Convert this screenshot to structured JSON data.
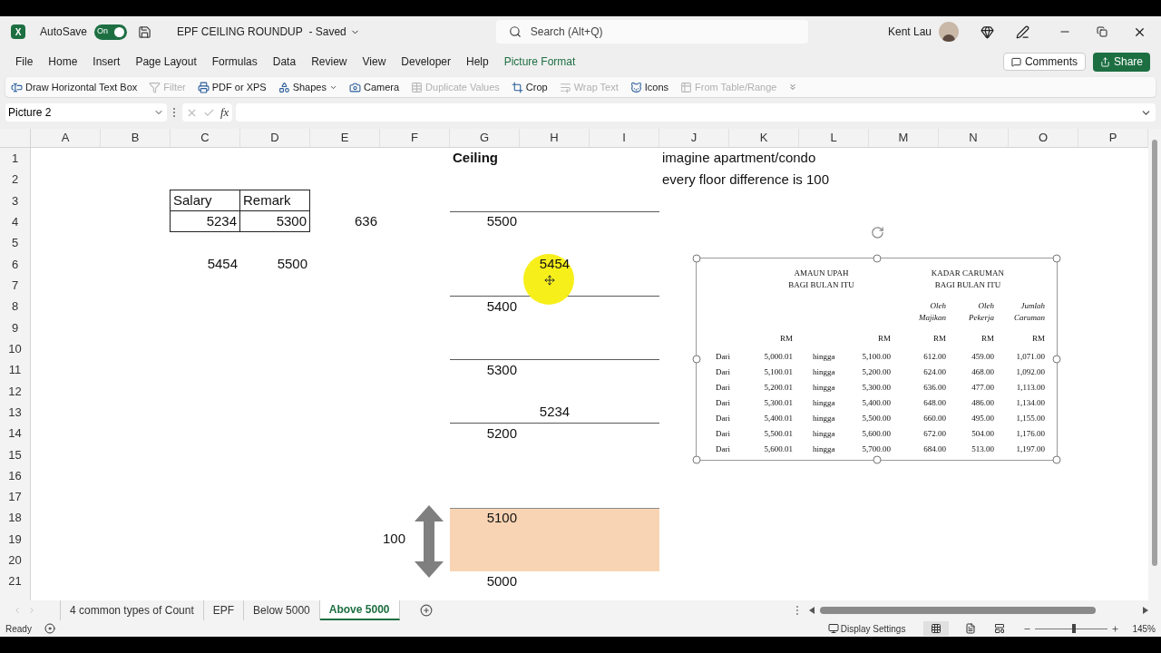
{
  "title_bar": {
    "app_logo": "X",
    "autosave_label": "AutoSave",
    "autosave": {
      "on": true,
      "label": "On"
    },
    "document_title": "EPF CEILING ROUNDUP",
    "save_status": "- Saved",
    "search_placeholder": "Search (Alt+Q)",
    "user_name": "Kent Lau"
  },
  "menu": [
    {
      "label": "File",
      "kind": "tab"
    },
    {
      "label": "Home",
      "kind": "tab"
    },
    {
      "label": "Insert",
      "kind": "tab"
    },
    {
      "label": "Page Layout",
      "kind": "tab"
    },
    {
      "label": "Formulas",
      "kind": "tab"
    },
    {
      "label": "Data",
      "kind": "tab"
    },
    {
      "label": "Review",
      "kind": "tab"
    },
    {
      "label": "View",
      "kind": "tab"
    },
    {
      "label": "Developer",
      "kind": "tab"
    },
    {
      "label": "Help",
      "kind": "tab"
    },
    {
      "label": "Picture Format",
      "kind": "contextual"
    }
  ],
  "ribbon_buttons": [
    "Comments",
    "Share"
  ],
  "quick_access": [
    {
      "label": "Draw Horizontal Text Box",
      "disabled": false,
      "dropdown": false
    },
    {
      "label": "Filter",
      "disabled": true,
      "dropdown": false
    },
    {
      "label": "PDF or XPS",
      "disabled": false,
      "dropdown": false
    },
    {
      "label": "Shapes",
      "disabled": false,
      "dropdown": true
    },
    {
      "label": "Camera",
      "disabled": false,
      "dropdown": false
    },
    {
      "label": "Duplicate Values",
      "disabled": true,
      "dropdown": false
    },
    {
      "label": "Crop",
      "disabled": false,
      "dropdown": false
    },
    {
      "label": "Wrap Text",
      "disabled": true,
      "dropdown": false
    },
    {
      "label": "Icons",
      "disabled": false,
      "dropdown": false
    },
    {
      "label": "From Table/Range",
      "disabled": true,
      "dropdown": false
    }
  ],
  "formula_bar": {
    "name_box": "Picture 2",
    "function_label": "fx"
  },
  "columns": [
    "A",
    "B",
    "C",
    "D",
    "E",
    "F",
    "G",
    "H",
    "I",
    "J",
    "K",
    "L",
    "M",
    "N",
    "O",
    "P"
  ],
  "rows": [
    "1",
    "2",
    "3",
    "4",
    "5",
    "6",
    "7",
    "8",
    "9",
    "10",
    "11",
    "12",
    "13",
    "14",
    "15",
    "16",
    "17",
    "18",
    "19",
    "20",
    "21"
  ],
  "cells": [
    {
      "text": "Ceiling",
      "kind": "bold",
      "bordered": false
    },
    {
      "text": "imagine apartment/condo",
      "kind": "text",
      "bordered": false
    },
    {
      "text": "every floor difference is 100",
      "kind": "text",
      "bordered": false
    },
    {
      "text": "Salary",
      "kind": "text",
      "bordered": true
    },
    {
      "text": "Remark",
      "kind": "text",
      "bordered": true
    },
    {
      "text": "5234",
      "kind": "number",
      "bordered": true
    },
    {
      "text": "5300",
      "kind": "number",
      "bordered": true
    },
    {
      "text": "636",
      "kind": "number",
      "bordered": false
    },
    {
      "text": "5500",
      "kind": "number",
      "bordered": false
    },
    {
      "text": "5454",
      "kind": "number",
      "bordered": false
    },
    {
      "text": "5500",
      "kind": "number",
      "bordered": false
    },
    {
      "text": "5454",
      "kind": "center",
      "bordered": false
    },
    {
      "text": "5400",
      "kind": "number",
      "bordered": false
    },
    {
      "text": "5300",
      "kind": "number",
      "bordered": false
    },
    {
      "text": "5234",
      "kind": "center",
      "bordered": false
    },
    {
      "text": "5200",
      "kind": "number",
      "bordered": false
    },
    {
      "text": "5100",
      "kind": "number",
      "bordered": false
    },
    {
      "text": "100",
      "kind": "text",
      "bordered": false
    },
    {
      "text": "5000",
      "kind": "number",
      "bordered": false
    }
  ],
  "epf_table": {
    "group_headers": [
      [
        "AMAUN UPAH",
        "BAGI BULAN ITU"
      ],
      [
        "KADAR CARUMAN",
        "BAGI BULAN ITU"
      ]
    ],
    "sub_headers": [
      [
        "Oleh",
        "Majikan"
      ],
      [
        "Oleh",
        "Pekerja"
      ],
      [
        "Jumlah",
        "Caruman"
      ]
    ],
    "currency": [
      "RM",
      "RM",
      "RM",
      "RM",
      "RM"
    ],
    "rows": [
      [
        "Dari",
        "5,000.01",
        "hingga",
        "5,100.00",
        "612.00",
        "459.00",
        "1,071.00"
      ],
      [
        "Dari",
        "5,100.01",
        "hingga",
        "5,200.00",
        "624.00",
        "468.00",
        "1,092.00"
      ],
      [
        "Dari",
        "5,200.01",
        "hingga",
        "5,300.00",
        "636.00",
        "477.00",
        "1,113.00"
      ],
      [
        "Dari",
        "5,300.01",
        "hingga",
        "5,400.00",
        "648.00",
        "486.00",
        "1,134.00"
      ],
      [
        "Dari",
        "5,400.01",
        "hingga",
        "5,500.00",
        "660.00",
        "495.00",
        "1,155.00"
      ],
      [
        "Dari",
        "5,500.01",
        "hingga",
        "5,600.00",
        "672.00",
        "504.00",
        "1,176.00"
      ],
      [
        "Dari",
        "5,600.01",
        "hingga",
        "5,700.00",
        "684.00",
        "513.00",
        "1,197.00"
      ]
    ]
  },
  "sheet_tabs": [
    {
      "label": "4 common types of Count",
      "selected": false
    },
    {
      "label": "EPF",
      "selected": false
    },
    {
      "label": "Below 5000",
      "selected": false
    },
    {
      "label": "Above 5000",
      "selected": true
    }
  ],
  "status_bar": {
    "status": "Ready",
    "display_settings": "Display Settings",
    "zoom": {
      "level": 0.53,
      "reading": "145%"
    }
  }
}
